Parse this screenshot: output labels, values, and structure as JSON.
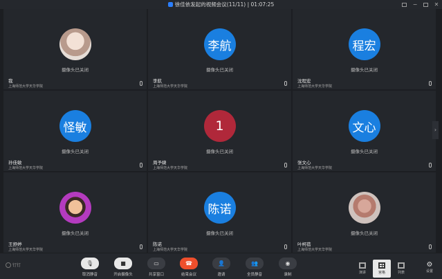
{
  "window": {
    "title": "徐佳依发起的视频会议(11/11) | 01:07:25"
  },
  "camera_off_text": "摄像头已关闭",
  "participants": [
    {
      "name": "我",
      "org": "上海师范大学天华学院",
      "avatar_text": "",
      "avatar_style": "photo1",
      "mic": true
    },
    {
      "name": "李航",
      "org": "上海师范大学天华学院",
      "avatar_text": "李航",
      "avatar_style": "blue",
      "mic": true
    },
    {
      "name": "沈程宏",
      "org": "上海师范大学天华学院",
      "avatar_text": "程宏",
      "avatar_style": "blue",
      "mic": true
    },
    {
      "name": "孙佳敏",
      "org": "上海师范大学天华学院",
      "avatar_text": "怪敏",
      "avatar_style": "blue",
      "mic": true
    },
    {
      "name": "周予婕",
      "org": "上海师范大学天华学院",
      "avatar_text": "1",
      "avatar_style": "red",
      "mic": true
    },
    {
      "name": "张文心",
      "org": "上海师范大学天华学院",
      "avatar_text": "文心",
      "avatar_style": "blue",
      "mic": true
    },
    {
      "name": "王舒婷",
      "org": "上海师范大学天华学院",
      "avatar_text": "",
      "avatar_style": "photo2",
      "mic": true
    },
    {
      "name": "陈诺",
      "org": "上海师范大学天华学院",
      "avatar_text": "陈诺",
      "avatar_style": "blue",
      "mic": true
    },
    {
      "name": "叶柯蓓",
      "org": "上海师范大学天华学院",
      "avatar_text": "",
      "avatar_style": "photo3",
      "mic": true
    }
  ],
  "toolbar": {
    "brand": "钉钉",
    "buttons": [
      {
        "label": "取消静音",
        "icon": "mic-muted-icon"
      },
      {
        "label": "开启摄像头",
        "icon": "camera-off-icon"
      },
      {
        "label": "共享窗口",
        "icon": "share-screen-icon"
      },
      {
        "label": "结束会议",
        "icon": "hangup-icon"
      },
      {
        "label": "邀请",
        "icon": "invite-icon"
      },
      {
        "label": "全员静音",
        "icon": "mute-all-icon"
      },
      {
        "label": "录制",
        "icon": "record-icon"
      }
    ],
    "layouts": [
      {
        "label": "演讲"
      },
      {
        "label": "宫格"
      },
      {
        "label": "列表"
      }
    ],
    "settings_label": "设置"
  }
}
